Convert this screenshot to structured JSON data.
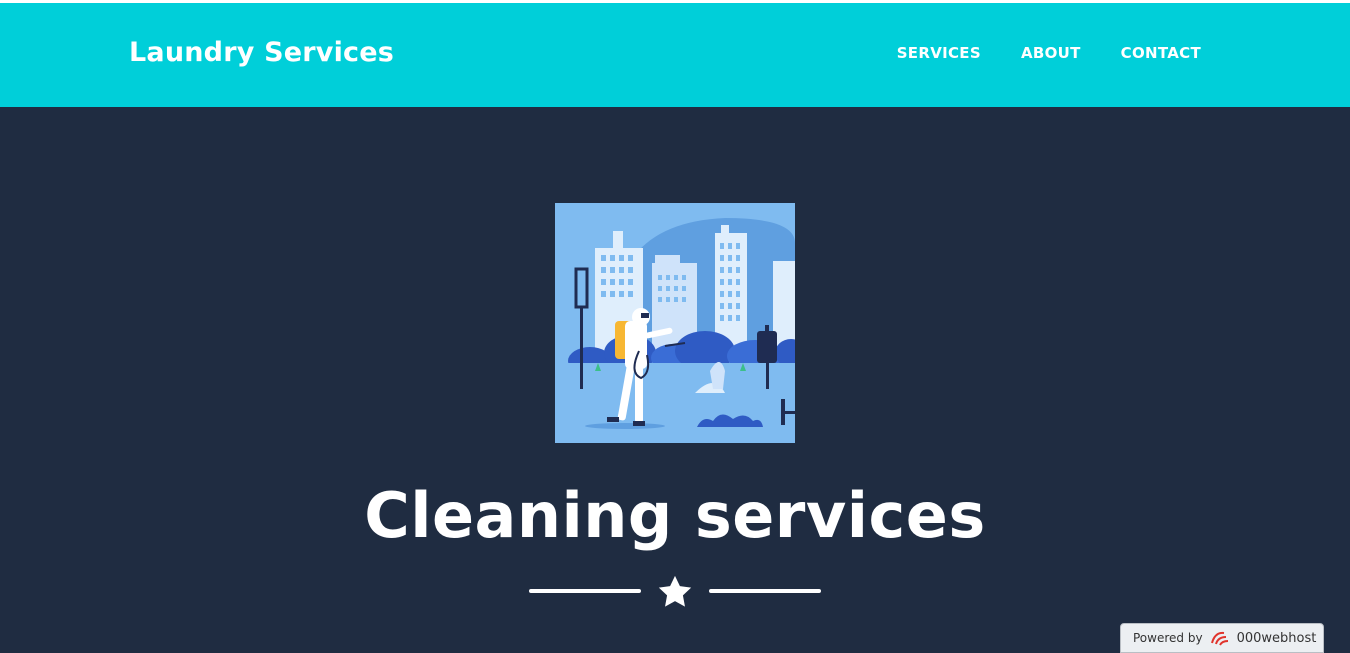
{
  "brand": {
    "title": "Laundry Services"
  },
  "nav": {
    "items": [
      "SERVICES",
      "ABOUT",
      "CONTACT"
    ]
  },
  "hero": {
    "title": "Cleaning services"
  },
  "footer_badge": {
    "powered": "Powered by",
    "brand": "000webhost"
  },
  "colors": {
    "navbar": "#00cfd9",
    "background": "#1f2c41",
    "text": "#ffffff",
    "illustration_bg": "#7fbbf0"
  },
  "icons": {
    "divider": "star-icon",
    "badge": "000webhost-logo-icon"
  }
}
